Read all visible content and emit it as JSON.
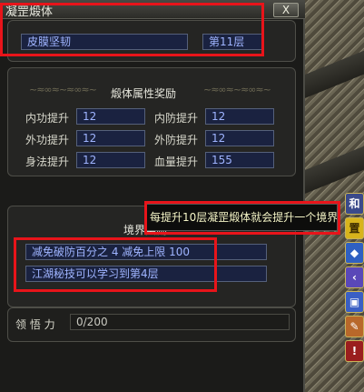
{
  "window": {
    "title": "凝罡煅体",
    "close_label": "X"
  },
  "header": {
    "skill_name": "皮膜坚韧",
    "level": "第11层"
  },
  "attributes": {
    "section_title": "煅体属性奖励",
    "items": [
      {
        "label": "内功提升",
        "value": "12"
      },
      {
        "label": "内防提升",
        "value": "12"
      },
      {
        "label": "外功提升",
        "value": "12"
      },
      {
        "label": "外防提升",
        "value": "12"
      },
      {
        "label": "身法提升",
        "value": "12"
      },
      {
        "label": "血量提升",
        "value": "155"
      }
    ]
  },
  "realm": {
    "section_title": "境界奖励",
    "rewards": [
      "减免破防百分之 4 减免上限 100",
      "江湖秘技可以学习到第4层"
    ]
  },
  "tooltip": {
    "text": "每提升10层凝罡煅体就会提升一个境界"
  },
  "comprehension": {
    "label": "领 悟 力",
    "value": "0/200"
  },
  "side_icons": [
    {
      "name": "harmony-icon",
      "glyph": "和"
    },
    {
      "name": "gold-icon",
      "glyph": "置"
    },
    {
      "name": "shield-icon",
      "glyph": "◆"
    },
    {
      "name": "back-arrow-icon",
      "glyph": "‹"
    },
    {
      "name": "bag-icon",
      "glyph": "▣"
    },
    {
      "name": "pencil-icon",
      "glyph": "✎"
    },
    {
      "name": "alert-icon",
      "glyph": "!"
    }
  ]
}
